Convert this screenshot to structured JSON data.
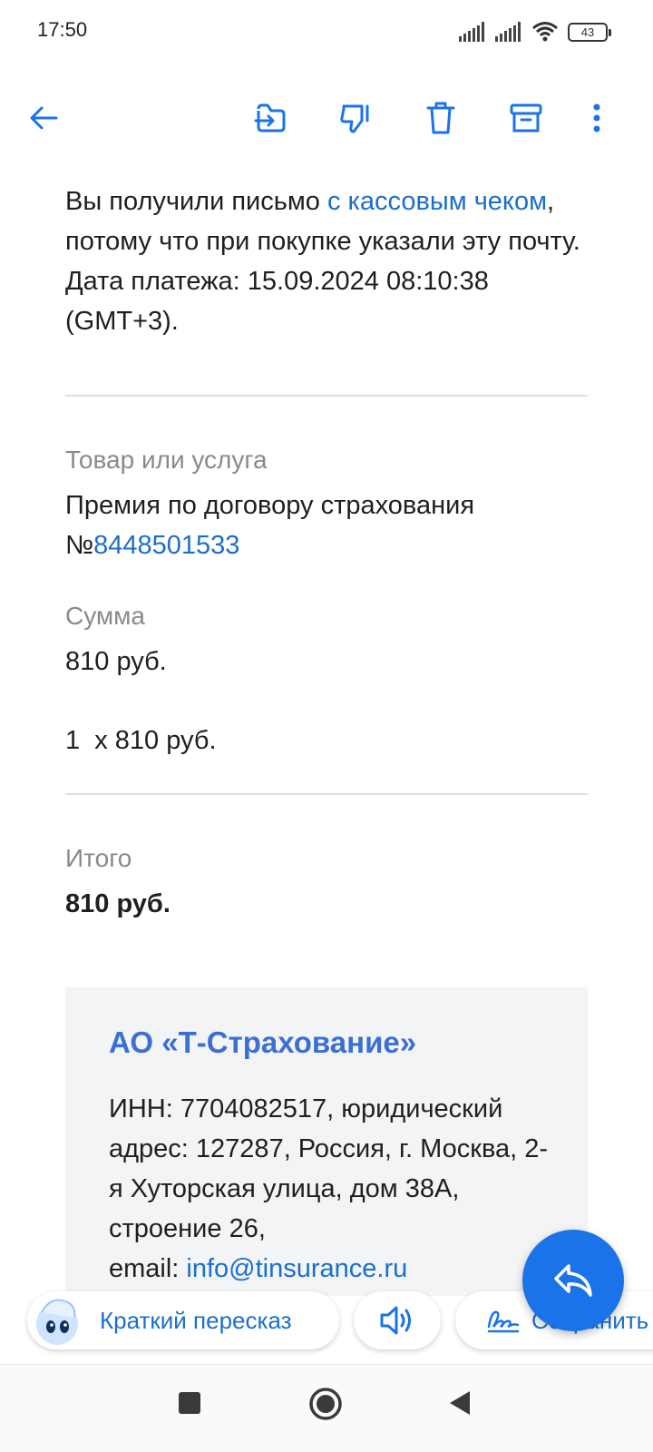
{
  "status_bar": {
    "time": "17:50",
    "battery": "43"
  },
  "toolbar": {
    "icons": [
      "back-arrow-icon",
      "move-to-icon",
      "spam-icon",
      "delete-icon",
      "archive-icon",
      "more-icon"
    ]
  },
  "email": {
    "intro_prefix": "Вы получили письмо ",
    "intro_link": "с кассовым чеком",
    "intro_suffix": ", потому что при покупке указали эту почту. Дата платежа: 15.09.2024 08:10:38 (GMT+3).",
    "item_label": "Товар или услуга",
    "item_value_prefix": "Премия по договору страхования №",
    "item_number": "8448501533",
    "sum_label": "Сумма",
    "sum_value": "810 руб.",
    "qty_line": "1  x 810 руб.",
    "total_label": "Итого",
    "total_value": "810 руб."
  },
  "company": {
    "name": "АО «Т-Страхование»",
    "details": "ИНН: 7704082517, юридический адрес: 127287, Россия, г. Москва, 2-я Хуторская улица, дом 38А, строение 26,",
    "email_label": "email: ",
    "email": "info@tinsurance.ru"
  },
  "bottom_actions": {
    "summary_label": "Краткий пересказ",
    "save_label": "Сохранить"
  },
  "colors": {
    "accent": "#1a73e8",
    "link": "#1a6fcc",
    "company_name": "#3b6fd4"
  }
}
